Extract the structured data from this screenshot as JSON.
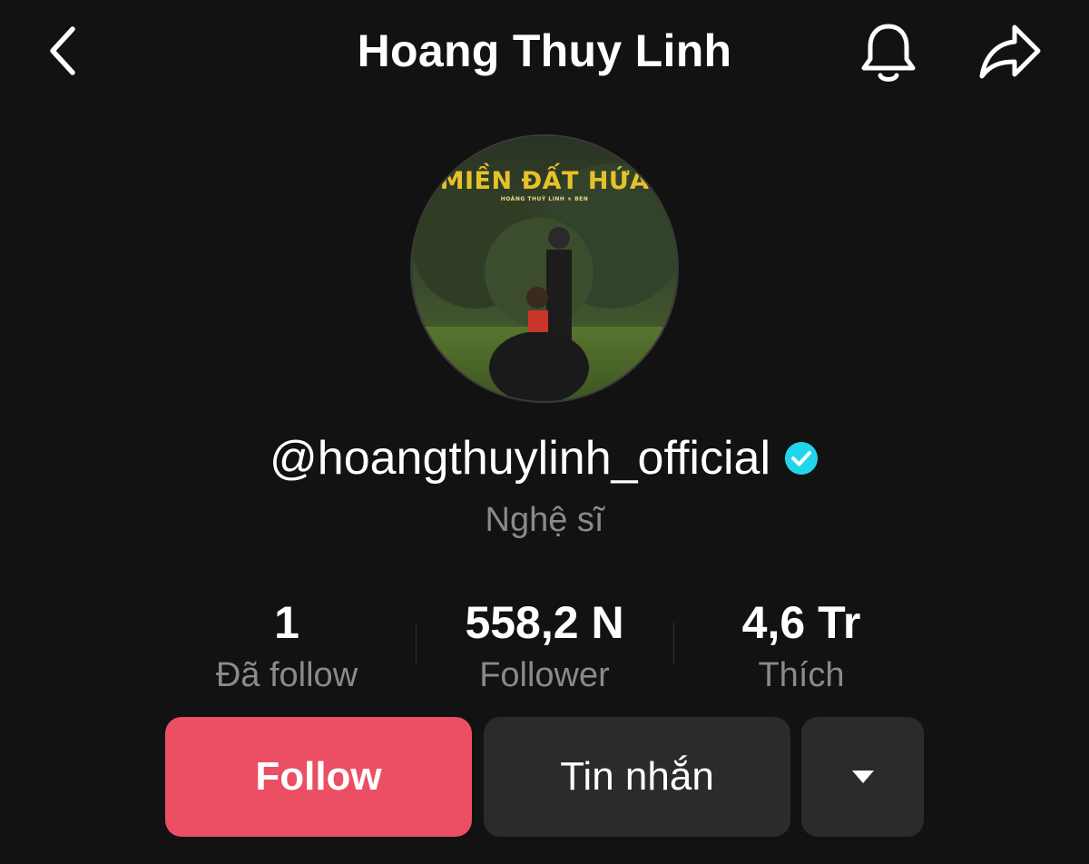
{
  "header": {
    "title": "Hoang Thuy Linh",
    "back_icon": "chevron-left-icon",
    "notify_icon": "bell-icon",
    "share_icon": "share-arrow-icon"
  },
  "profile": {
    "avatar": {
      "title_text": "MIỀN ĐẤT HỨA",
      "subtitle_text": "HOÀNG THUỲ LINH × BEN"
    },
    "handle": "@hoangthuylinh_official",
    "verified": true,
    "verified_color": "#20d5ec",
    "category": "Nghệ sĩ"
  },
  "stats": [
    {
      "value": "1",
      "label": "Đã follow"
    },
    {
      "value": "558,2 N",
      "label": "Follower"
    },
    {
      "value": "4,6 Tr",
      "label": "Thích"
    }
  ],
  "actions": {
    "follow_label": "Follow",
    "follow_color": "#ea4f63",
    "message_label": "Tin nhắn",
    "more_icon": "caret-down-icon"
  }
}
